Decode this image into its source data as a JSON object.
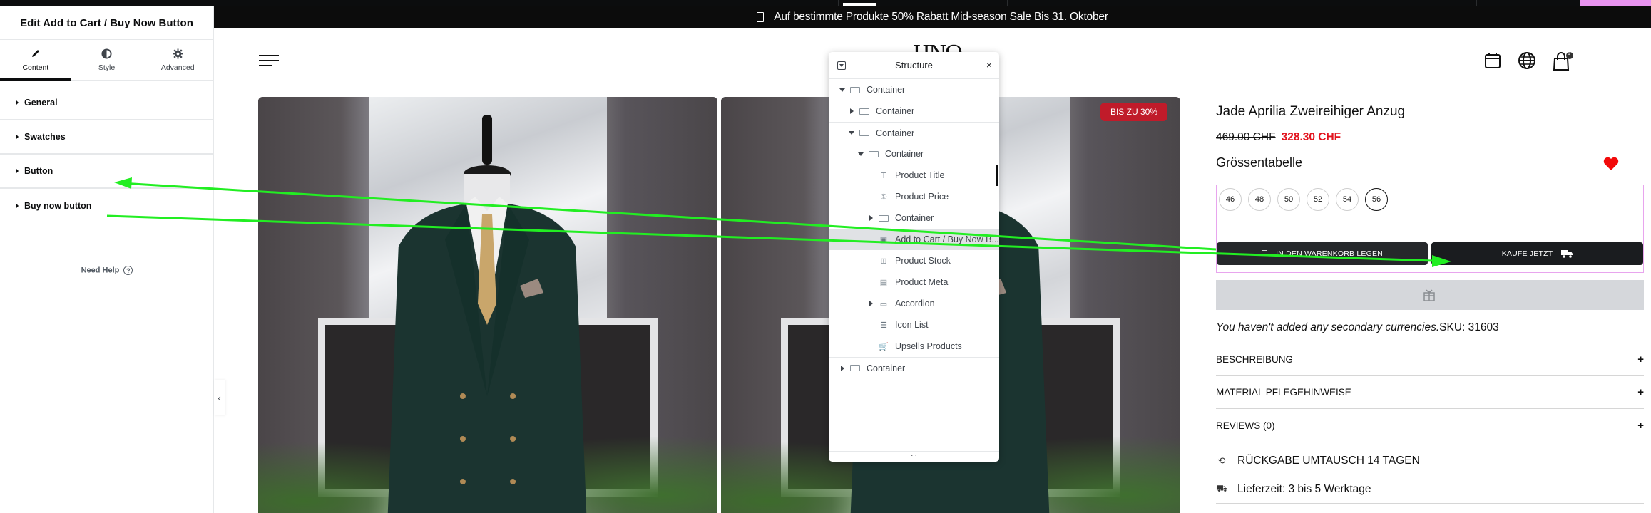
{
  "editor": {
    "title": "Edit Add to Cart / Buy Now Button",
    "tabs": [
      {
        "label": "Content",
        "icon": "pencil-icon",
        "active": true
      },
      {
        "label": "Style",
        "icon": "contrast-icon",
        "active": false
      },
      {
        "label": "Advanced",
        "icon": "gear-icon",
        "active": false
      }
    ],
    "sections": [
      {
        "label": "General"
      },
      {
        "label": "Swatches"
      },
      {
        "label": "Button"
      },
      {
        "label": "Buy now button"
      }
    ],
    "help_label": "Need Help",
    "help_icon": "?",
    "collapse_icon": "‹"
  },
  "banner": {
    "text": "Auf bestimmte Produkte 50% Rabatt Mid-season Sale Bis 31. Oktober"
  },
  "header": {
    "logo": "HNO",
    "cart_count": "1"
  },
  "gallery": {
    "badge": "BIS ZU 30%"
  },
  "structure": {
    "title": "Structure",
    "close_icon": "×",
    "footer": "...",
    "items": [
      {
        "label": "Container",
        "level": 0,
        "arrow": "down",
        "icon": "container-icon"
      },
      {
        "label": "Container",
        "level": 1,
        "arrow": "right",
        "icon": "container-icon"
      },
      {
        "label": "Container",
        "level": 1,
        "arrow": "down",
        "icon": "container-icon",
        "separator": true
      },
      {
        "label": "Container",
        "level": 2,
        "arrow": "down",
        "icon": "container-icon"
      },
      {
        "label": "Product Title",
        "level": 3,
        "arrow": "",
        "icon": "product-title-icon"
      },
      {
        "label": "Product Price",
        "level": 3,
        "arrow": "",
        "icon": "product-price-icon"
      },
      {
        "label": "Container",
        "level": 3,
        "arrow": "right",
        "icon": "container-icon"
      },
      {
        "label": "Add to Cart / Buy Now B...",
        "level": 3,
        "arrow": "",
        "icon": "add-to-cart-icon",
        "selected": true
      },
      {
        "label": "Product Stock",
        "level": 3,
        "arrow": "",
        "icon": "product-stock-icon"
      },
      {
        "label": "Product Meta",
        "level": 3,
        "arrow": "",
        "icon": "product-meta-icon"
      },
      {
        "label": "Accordion",
        "level": 3,
        "arrow": "right",
        "icon": "accordion-icon"
      },
      {
        "label": "Icon List",
        "level": 3,
        "arrow": "",
        "icon": "icon-list-icon"
      },
      {
        "label": "Upsells Products",
        "level": 3,
        "arrow": "",
        "icon": "cart-icon"
      },
      {
        "label": "Container",
        "level": 0,
        "arrow": "right",
        "icon": "container-icon",
        "separator": true
      }
    ]
  },
  "product": {
    "title": "Jade Aprilia Zweireihiger Anzug",
    "old_price": "469.00 CHF",
    "new_price": "328.30 CHF",
    "size_chart": "Grössentabelle",
    "sizes": [
      {
        "label": "46",
        "selected": false
      },
      {
        "label": "48",
        "selected": false
      },
      {
        "label": "50",
        "selected": false
      },
      {
        "label": "52",
        "selected": false
      },
      {
        "label": "54",
        "selected": false
      },
      {
        "label": "56",
        "selected": true
      }
    ],
    "add_to_cart_label": "IN DEN WARENKORB LEGEN",
    "buy_now_label": "KAUFE JETZT",
    "currency_note": "You haven't added any secondary currencies.",
    "sku_label": "SKU:",
    "sku_value": "31603",
    "accordion": [
      {
        "label": "BESCHREIBUNG",
        "icon": "+"
      },
      {
        "label": "MATERIAL PFLEGEHINWEISE",
        "icon": "+"
      },
      {
        "label": "REVIEWS (0)",
        "icon": "+"
      }
    ],
    "features": [
      {
        "label": "RÜCKGABE UMTAUSCH 14 TAGEN",
        "icon": "return-icon"
      },
      {
        "label": "Lieferzeit: 3 bis 5 Werktage",
        "icon": "delivery-truck-icon"
      }
    ]
  },
  "colors": {
    "accent_red": "#e2121d",
    "badge_red": "#c01b2a",
    "selection_outline": "#e8a5ee",
    "annotation_arrow": "#22ee22"
  }
}
